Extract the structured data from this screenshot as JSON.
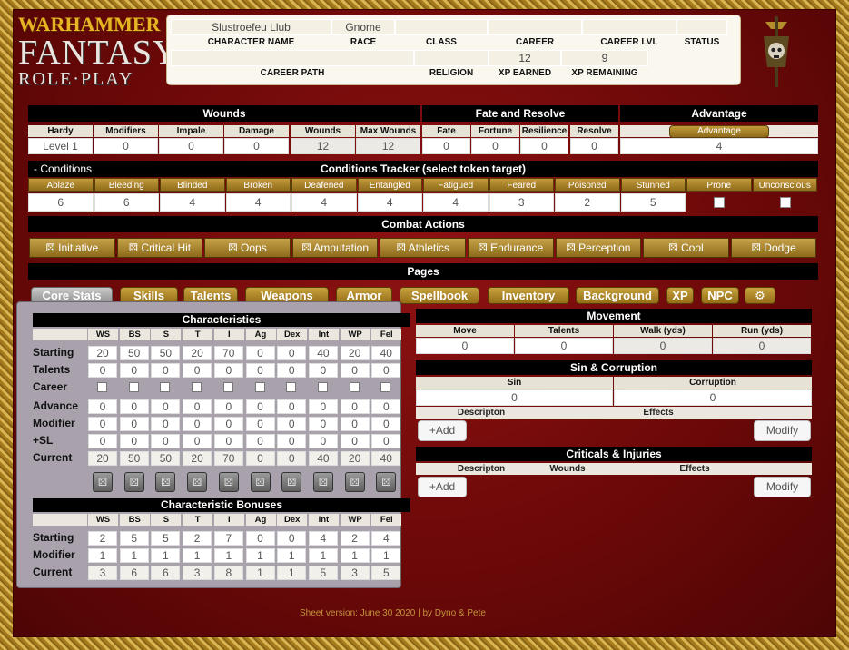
{
  "logo": {
    "line1": "WARHAMMER",
    "line2": "FANTASY",
    "line3": "ROLE·PLAY"
  },
  "character": {
    "name_value": "Slustroefeu Llub",
    "race_value": "Gnome",
    "class_value": "",
    "career_value": "",
    "career_lvl_value": "",
    "status_value": "",
    "career_path_value": "",
    "religion_value": "",
    "xp_earned_value": "12",
    "xp_remaining_value": "9",
    "labels": {
      "name": "CHARACTER NAME",
      "race": "RACE",
      "class": "CLASS",
      "career": "CAREER",
      "career_lvl": "CAREER LVL",
      "status": "STATUS",
      "career_path": "CAREER PATH",
      "religion": "RELIGION",
      "xp_earned": "XP EARNED",
      "xp_remaining": "XP REMAINING"
    }
  },
  "wounds": {
    "title": "Wounds",
    "headers": [
      "Hardy",
      "Modifiers",
      "Impale",
      "Damage",
      "Wounds",
      "Max Wounds"
    ],
    "values": [
      "Level 1",
      "0",
      "0",
      "0",
      "12",
      "12"
    ]
  },
  "fate": {
    "title": "Fate and Resolve",
    "headers": [
      "Fate",
      "Fortune",
      "Resilience",
      "Resolve"
    ],
    "values": [
      "0",
      "0",
      "0",
      "0"
    ]
  },
  "advantage": {
    "title": "Advantage",
    "button": "Advantage",
    "value": "4"
  },
  "conditions": {
    "toggle": "- Conditions",
    "title": "Conditions Tracker (select token target)",
    "items": [
      {
        "label": "Ablaze",
        "value": "6"
      },
      {
        "label": "Bleeding",
        "value": "6"
      },
      {
        "label": "Blinded",
        "value": "4"
      },
      {
        "label": "Broken",
        "value": "4"
      },
      {
        "label": "Deafened",
        "value": "4"
      },
      {
        "label": "Entangled",
        "value": "4"
      },
      {
        "label": "Fatigued",
        "value": "4"
      },
      {
        "label": "Feared",
        "value": "3"
      },
      {
        "label": "Poisoned",
        "value": "2"
      },
      {
        "label": "Stunned",
        "value": "5"
      },
      {
        "label": "Prone",
        "value": ""
      },
      {
        "label": "Unconscious",
        "value": ""
      }
    ]
  },
  "combat": {
    "title": "Combat Actions",
    "actions": [
      "Initiative",
      "Critical Hit",
      "Oops",
      "Amputation",
      "Athletics",
      "Endurance",
      "Perception",
      "Cool",
      "Dodge"
    ]
  },
  "pages": {
    "title": "Pages",
    "tabs": [
      "Core Stats",
      "Skills",
      "Talents",
      "Weapons",
      "Armor",
      "Spellbook",
      "Inventory",
      "Background",
      "XP",
      "NPC"
    ]
  },
  "characteristics": {
    "title": "Characteristics",
    "cols": [
      "WS",
      "BS",
      "S",
      "T",
      "I",
      "Ag",
      "Dex",
      "Int",
      "WP",
      "Fel"
    ],
    "rows": [
      {
        "label": "Starting",
        "values": [
          "20",
          "50",
          "50",
          "20",
          "70",
          "0",
          "0",
          "40",
          "20",
          "40"
        ]
      },
      {
        "label": "Talents",
        "values": [
          "0",
          "0",
          "0",
          "0",
          "0",
          "0",
          "0",
          "0",
          "0",
          "0"
        ]
      },
      {
        "label": "Career",
        "values": []
      },
      {
        "label": "Advance",
        "values": [
          "0",
          "0",
          "0",
          "0",
          "0",
          "0",
          "0",
          "0",
          "0",
          "0"
        ]
      },
      {
        "label": "Modifier",
        "values": [
          "0",
          "0",
          "0",
          "0",
          "0",
          "0",
          "0",
          "0",
          "0",
          "0"
        ]
      },
      {
        "label": "+SL",
        "values": [
          "0",
          "0",
          "0",
          "0",
          "0",
          "0",
          "0",
          "0",
          "0",
          "0"
        ]
      },
      {
        "label": "Current",
        "values": [
          "20",
          "50",
          "50",
          "20",
          "70",
          "0",
          "0",
          "40",
          "20",
          "40"
        ]
      }
    ]
  },
  "bonuses": {
    "title": "Characteristic Bonuses",
    "cols": [
      "WS",
      "BS",
      "S",
      "T",
      "I",
      "Ag",
      "Dex",
      "Int",
      "WP",
      "Fel"
    ],
    "rows": [
      {
        "label": "Starting",
        "values": [
          "2",
          "5",
          "5",
          "2",
          "7",
          "0",
          "0",
          "4",
          "2",
          "4"
        ]
      },
      {
        "label": "Modifier",
        "values": [
          "1",
          "1",
          "1",
          "1",
          "1",
          "1",
          "1",
          "1",
          "1",
          "1"
        ]
      },
      {
        "label": "Current",
        "values": [
          "3",
          "6",
          "6",
          "3",
          "8",
          "1",
          "1",
          "5",
          "3",
          "5"
        ]
      }
    ]
  },
  "movement": {
    "title": "Movement",
    "headers": [
      "Move",
      "Talents",
      "Walk (yds)",
      "Run (yds)"
    ],
    "values": [
      "0",
      "0",
      "0",
      "0"
    ]
  },
  "sin": {
    "title": "Sin & Corruption",
    "headers": [
      "Sin",
      "Corruption"
    ],
    "values": [
      "0",
      "0"
    ],
    "col_desc": "Descripton",
    "col_effects": "Effects",
    "add_label": "+Add",
    "modify_label": "Modify"
  },
  "criticals": {
    "title": "Criticals & Injuries",
    "col_desc": "Descripton",
    "col_wounds": "Wounds",
    "col_effects": "Effects",
    "add_label": "+Add",
    "modify_label": "Modify"
  },
  "footer": "Sheet version: June 30 2020 | by Dyno & Pete",
  "colors": {
    "background": "#6a0808",
    "accent_gold": "#b38a2e",
    "bar": "#000000"
  }
}
